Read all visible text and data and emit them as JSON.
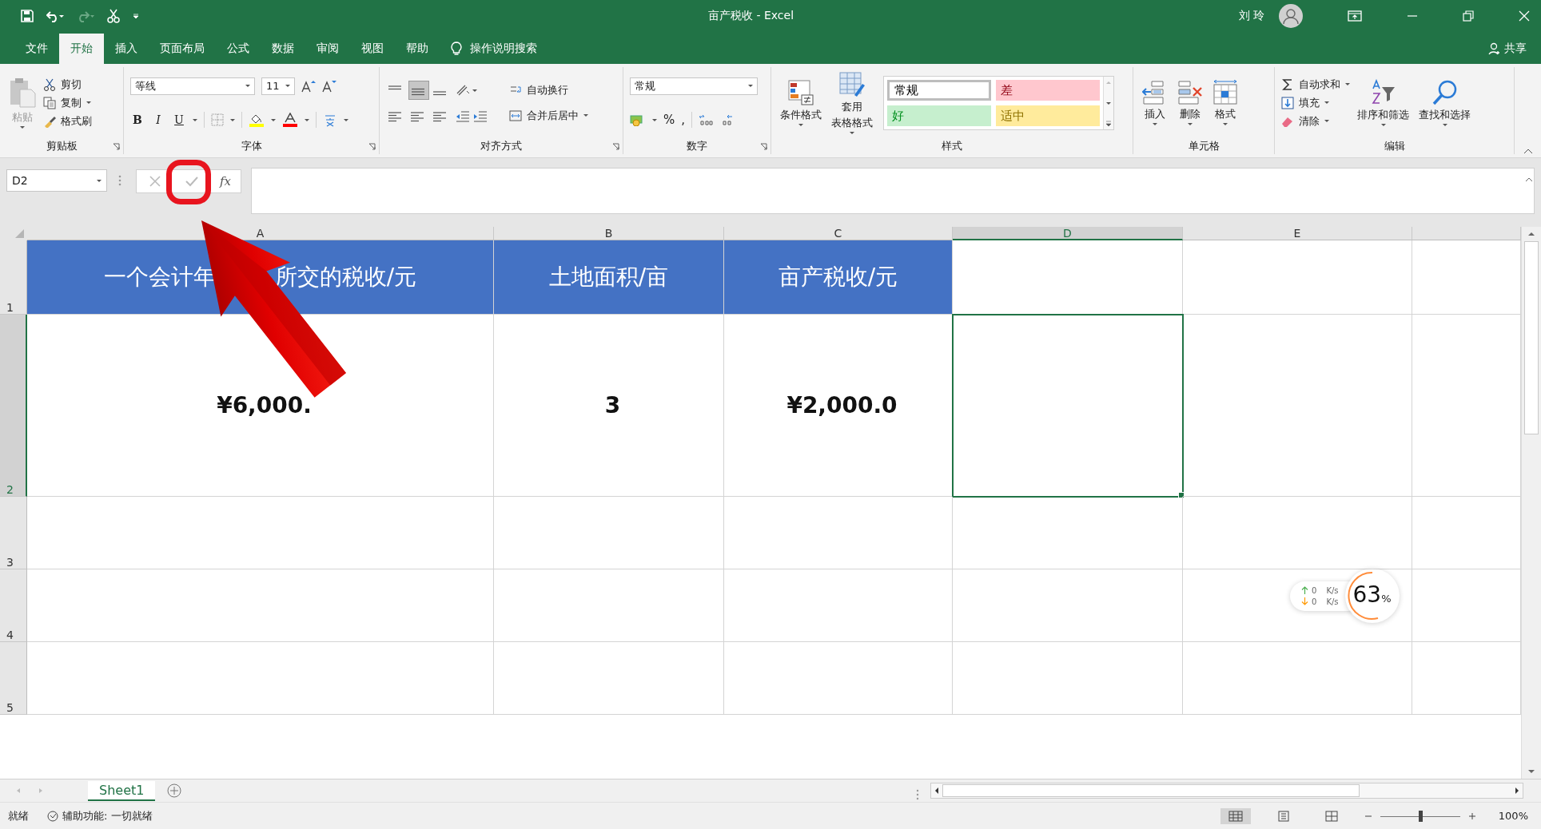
{
  "title_bar": {
    "title": "亩产税收  -  Excel",
    "user": "刘 玲"
  },
  "menu_tabs": [
    {
      "label": "文件",
      "selected": false
    },
    {
      "label": "开始",
      "selected": true
    },
    {
      "label": "插入",
      "selected": false
    },
    {
      "label": "页面布局",
      "selected": false
    },
    {
      "label": "公式",
      "selected": false
    },
    {
      "label": "数据",
      "selected": false
    },
    {
      "label": "审阅",
      "selected": false
    },
    {
      "label": "视图",
      "selected": false
    },
    {
      "label": "帮助",
      "selected": false
    }
  ],
  "tell_me": {
    "placeholder": "操作说明搜索"
  },
  "share": "共享",
  "ribbon": {
    "clipboard": {
      "label": "剪贴板",
      "paste": "粘贴",
      "actions": [
        "剪切",
        "复制",
        "格式刷"
      ]
    },
    "font": {
      "label": "字体",
      "font_name": "等线",
      "font_size": "11",
      "bold": "B",
      "italic": "I",
      "underline": "U"
    },
    "alignment": {
      "label": "对齐方式",
      "wrap_text": "自动换行",
      "merge_center": "合并后居中"
    },
    "number": {
      "label": "数字",
      "format": "常规",
      "percent": "%",
      "comma": ","
    },
    "styles": {
      "label": "样式",
      "conditional_formatting": "条件格式",
      "format_as_table": [
        "套用",
        "表格格式"
      ],
      "cell_styles": [
        {
          "name": "常规",
          "color": "#ffffff",
          "selected": true
        },
        {
          "name": "差",
          "color": "#ffc7ce",
          "selected": false
        },
        {
          "name": "好",
          "color": "#c6efce",
          "selected": false
        },
        {
          "name": "适中",
          "color": "#ffeb9c",
          "selected": false
        }
      ]
    },
    "cells": {
      "label": "单元格",
      "buttons": [
        "插入",
        "删除",
        "格式"
      ]
    },
    "editing": {
      "label": "编辑",
      "actions": [
        "自动求和",
        "填充",
        "清除"
      ],
      "sort_filter": "排序和筛选",
      "find_select": "查找和选择"
    }
  },
  "formula_bar": {
    "name_box": "D2",
    "function_label": "fx"
  },
  "sheet": {
    "columns": [
      {
        "label": "A",
        "selected": false
      },
      {
        "label": "B",
        "selected": false
      },
      {
        "label": "C",
        "selected": false
      },
      {
        "label": "D",
        "selected": true
      },
      {
        "label": "E",
        "selected": false
      }
    ],
    "rows": [
      {
        "label": "1",
        "selected": false,
        "cells": [
          {
            "kind": "heading",
            "parts": [
              "一个会计年",
              "所交的税收/元"
            ],
            "selected": false
          },
          {
            "kind": "heading",
            "parts": [
              "土地面积/亩"
            ],
            "selected": false
          },
          {
            "kind": "heading",
            "parts": [
              "亩产税收/元"
            ],
            "selected": false
          },
          {
            "kind": "blank",
            "selected": false
          },
          {
            "kind": "blank",
            "selected": false
          }
        ]
      },
      {
        "label": "2",
        "selected": true,
        "cells": [
          {
            "kind": "value",
            "parts": [
              "¥6,000."
            ],
            "selected": false
          },
          {
            "kind": "value",
            "parts": [
              "3"
            ],
            "selected": false
          },
          {
            "kind": "value",
            "parts": [
              "¥2,000.0"
            ],
            "selected": false
          },
          {
            "kind": "blank",
            "selected": true
          },
          {
            "kind": "blank",
            "selected": false
          }
        ]
      },
      {
        "label": "3",
        "selected": false
      },
      {
        "label": "4",
        "selected": false
      },
      {
        "label": "5",
        "selected": false
      }
    ]
  },
  "sheet_tabs": [
    {
      "label": "Sheet1",
      "selected": true
    }
  ],
  "status_bar": {
    "ready": "就绪",
    "accessibility": "辅助功能: 一切就绪",
    "zoom": "100%",
    "zoom_slider": {
      "level": 0.5
    }
  },
  "network_widget": {
    "upload": "0",
    "upload_unit": "K/s",
    "download": "0",
    "download_unit": "K/s",
    "percent": "63",
    "percent_sign": "%"
  }
}
